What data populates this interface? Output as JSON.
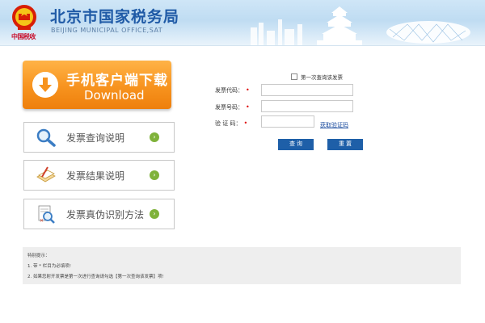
{
  "header": {
    "title": "北京市国家税务局",
    "subtitle": "BEIJING MUNICIPAL OFFICE,SAT"
  },
  "sidebar": {
    "download": {
      "label": "手机客户端下载",
      "sublabel": "Download"
    },
    "items": [
      {
        "label": "发票查询说明",
        "icon": "magnifier-icon"
      },
      {
        "label": "发票结果说明",
        "icon": "document-icon"
      },
      {
        "label": "发票真伪识别方法",
        "icon": "inspection-icon"
      }
    ]
  },
  "form": {
    "first_query_label": "第一次查询该发票",
    "fields": [
      {
        "label": "发票代码：",
        "value": ""
      },
      {
        "label": "发票号码：",
        "value": ""
      },
      {
        "label": "验 证 码：",
        "value": ""
      }
    ],
    "captcha_link": "获取验证码",
    "query_button": "查 询",
    "reset_button": "重 置"
  },
  "notice": {
    "title": "特别提示：",
    "lines": [
      "1. 带 * 栏目为必填项!",
      "2. 如果您射开发票是第一次进行查询请勾选【第一次查询该发票】项!"
    ]
  },
  "colors": {
    "brand_blue": "#1f5aa6",
    "download_orange": "#f7931e",
    "button_blue": "#1e5fa8",
    "required_red": "#dd0000"
  }
}
